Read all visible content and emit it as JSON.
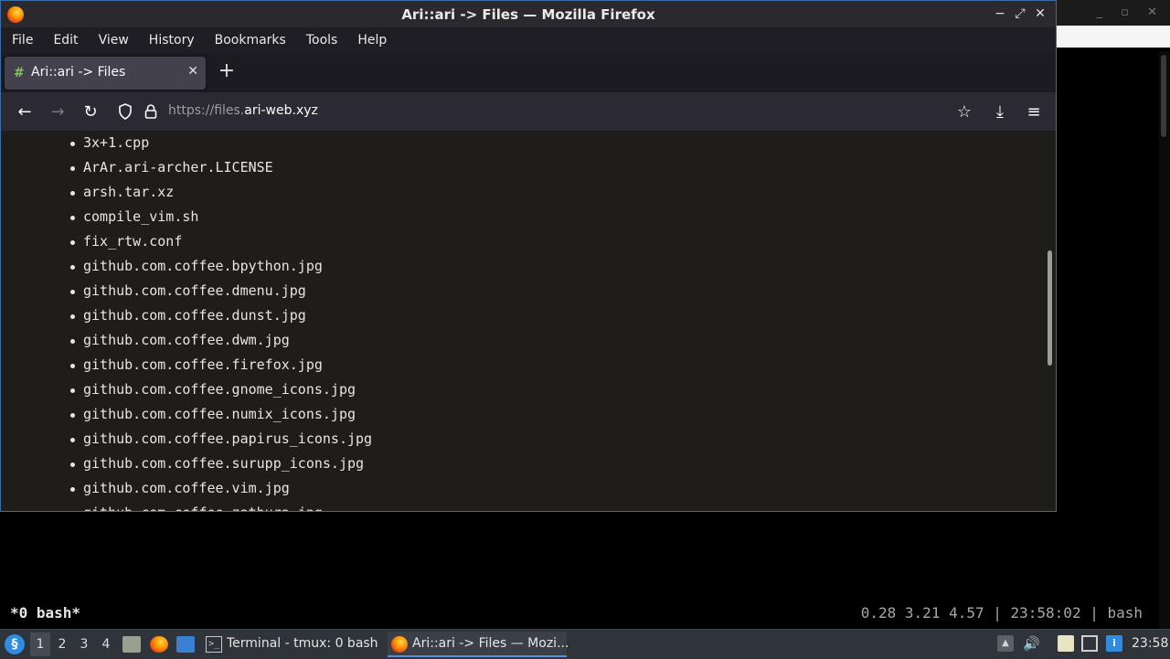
{
  "terminal": {
    "status_left": "*0 bash*",
    "status_right": "0.28 3.21 4.57 | 23:58:02 | bash"
  },
  "bg_window": {
    "controls": "_ ▫ ✕"
  },
  "firefox": {
    "window_title": "Ari::ari -> Files — Mozilla Firefox",
    "window_controls": {
      "minimize": "−",
      "maximize": "⤢",
      "close": "✕"
    },
    "menu": [
      "File",
      "Edit",
      "View",
      "History",
      "Bookmarks",
      "Tools",
      "Help"
    ],
    "tab": {
      "favicon": "#",
      "title": "Ari::ari -> Files",
      "close": "✕"
    },
    "new_tab": "+",
    "nav": {
      "back": "←",
      "forward": "→",
      "reload": "↻",
      "star": "☆",
      "download": "⤓",
      "menu": "≡"
    },
    "url": {
      "scheme": "https://",
      "sub": "files.",
      "domain": "ari-web.xyz"
    },
    "files": [
      "3x+1.cpp",
      "ArAr.ari-archer.LICENSE",
      "arsh.tar.xz",
      "compile_vim.sh",
      "fix_rtw.conf",
      "github.com.coffee.bpython.jpg",
      "github.com.coffee.dmenu.jpg",
      "github.com.coffee.dunst.jpg",
      "github.com.coffee.dwm.jpg",
      "github.com.coffee.firefox.jpg",
      "github.com.coffee.gnome_icons.jpg",
      "github.com.coffee.numix_icons.jpg",
      "github.com.coffee.papirus_icons.jpg",
      "github.com.coffee.surupp_icons.jpg",
      "github.com.coffee.vim.jpg",
      "github.com.coffee.zathura.jpg"
    ]
  },
  "taskbar": {
    "workspaces": [
      "1",
      "2",
      "3",
      "4"
    ],
    "tasks": [
      {
        "icon": ">_",
        "label": "Terminal - tmux: 0 bash"
      },
      {
        "label": "Ari::ari -> Files — Mozi..."
      }
    ],
    "tray": {
      "up": "▲",
      "volume": "🔊",
      "info": "i"
    },
    "clock": "23:58"
  },
  "colors": {
    "window_border": "#3b6ea8",
    "content_bg": "#1e1d1c",
    "taskbar_bg": "#2f343b"
  }
}
